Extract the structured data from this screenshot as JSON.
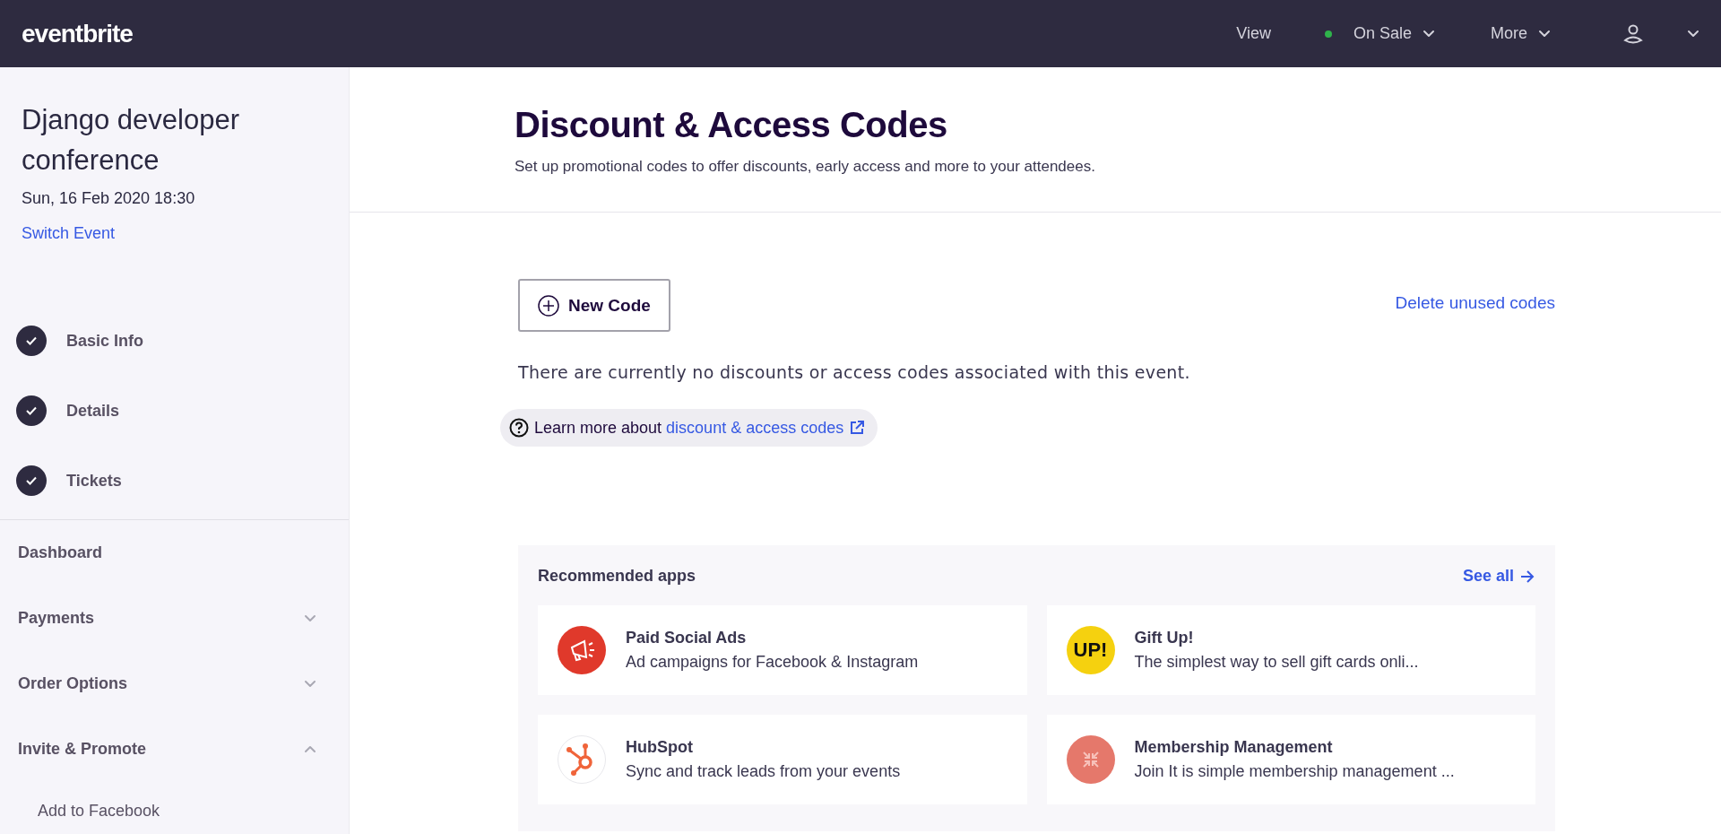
{
  "topbar": {
    "logo": "eventbrite",
    "view": "View",
    "status": {
      "label": "On Sale",
      "color": "#2fb34b"
    },
    "more": "More"
  },
  "sidebar": {
    "event_title": "Django developer conference",
    "event_date": "Sun, 16 Feb 2020 18:30",
    "switch_link": "Switch Event",
    "steps": [
      {
        "label": "Basic Info",
        "checked": true
      },
      {
        "label": "Details",
        "checked": true
      },
      {
        "label": "Tickets",
        "checked": true
      }
    ],
    "nav": [
      {
        "label": "Dashboard"
      },
      {
        "label": "Payments",
        "expanded": false
      },
      {
        "label": "Order Options",
        "expanded": false
      },
      {
        "label": "Invite & Promote",
        "expanded": true,
        "children": [
          {
            "label": "Add to Facebook"
          }
        ]
      }
    ]
  },
  "page": {
    "title": "Discount & Access Codes",
    "subtitle": "Set up promotional codes to offer discounts, early access and more to your attendees.",
    "new_code_button": "New Code",
    "delete_link": "Delete unused codes",
    "empty_message": "There are currently no discounts or access codes associated with this event.",
    "learn_more": {
      "text": "Learn more about ",
      "link": "discount & access codes"
    }
  },
  "recommended": {
    "title": "Recommended apps",
    "see_all": "See all",
    "apps": [
      {
        "kind": "megaphone",
        "name": "Paid Social Ads",
        "description": "Ad campaigns for Facebook & Instagram"
      },
      {
        "kind": "badge",
        "logo_text": "UP!",
        "name": "Gift Up!",
        "description": "The simplest way to sell gift cards onli..."
      },
      {
        "kind": "hub",
        "name": "HubSpot",
        "description": "Sync and track leads from your events"
      },
      {
        "kind": "arrows",
        "name": "Membership Management",
        "description": "Join It is simple membership management ..."
      }
    ]
  }
}
